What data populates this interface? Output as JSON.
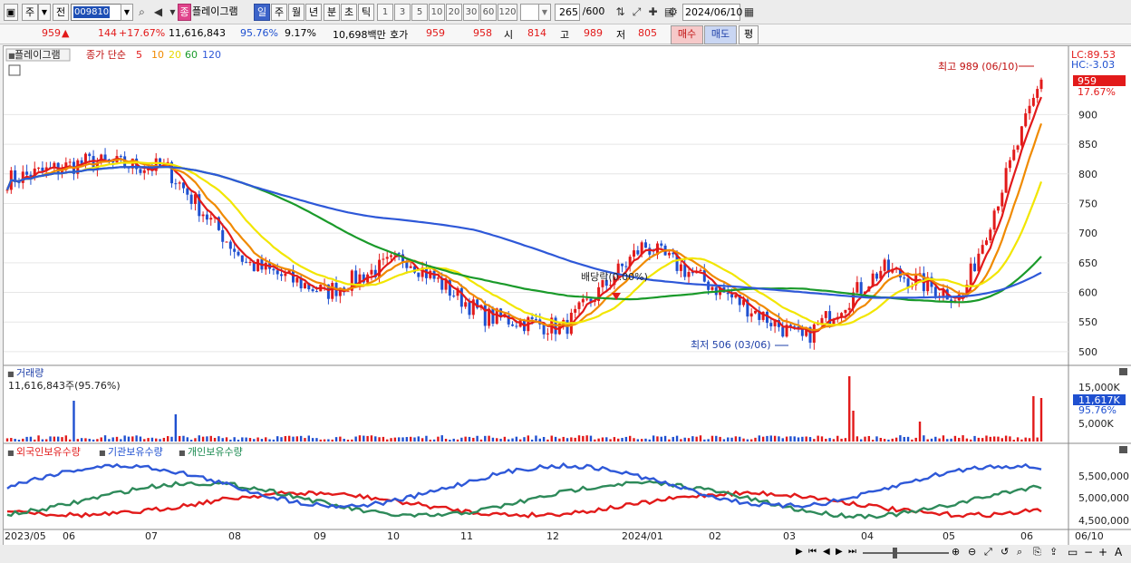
{
  "toolbar": {
    "type_label": "주",
    "prev_label": "전",
    "code": "009810",
    "program_badge": "종",
    "program_name": "플레이그램",
    "periods": [
      "일",
      "주",
      "월",
      "년",
      "분",
      "초",
      "틱"
    ],
    "minute_steps": [
      "1",
      "3",
      "5",
      "10",
      "20",
      "30",
      "60",
      "120"
    ],
    "count": "265",
    "count_total": "/600",
    "date": "2024/06/10"
  },
  "quote": {
    "price": "959",
    "change": "144",
    "change_pct": "+17.67%",
    "volume": "11,616,843",
    "vol_ratio": "95.76%",
    "turnover": "9.17%",
    "amount": "10,698백만",
    "bid_label": "호가",
    "ask": "959",
    "bid": "958",
    "open_label": "시",
    "open": "814",
    "high_label": "고",
    "high": "989",
    "low_label": "저",
    "low": "805",
    "buy_label": "매수",
    "sell_label": "매도",
    "eval_label": "평"
  },
  "legend": {
    "name": "플레이그램",
    "ma_label": "종가 단순",
    "ma5": "5",
    "ma10": "10",
    "ma20": "20",
    "ma60": "60",
    "ma120": "120",
    "volume_title": "거래량",
    "volume_value": "11,616,843주(95.76%)",
    "inv1": "외국인보유수량",
    "inv2": "기관보유수량",
    "inv3": "개인보유수량"
  },
  "price_axis": {
    "lc": "LC:89.53",
    "hc": "HC:-3.03",
    "current": "959",
    "current_pct": "17.67%",
    "ticks": [
      "900",
      "850",
      "800",
      "750",
      "700",
      "650",
      "600",
      "550",
      "500"
    ]
  },
  "volume_axis": {
    "ticks": [
      "15,000K",
      "5,000K"
    ],
    "current": "11,617K",
    "current_pct": "95.76%"
  },
  "investor_axis": {
    "ticks": [
      "5,500,000",
      "5,000,000",
      "4,500,000"
    ]
  },
  "annotations": {
    "high": "최고 989 (06/10)",
    "low": "최저 506 (03/06)",
    "dividend": "배당락(0.00%)"
  },
  "x_axis": {
    "labels": [
      "2023/05",
      "06",
      "07",
      "08",
      "09",
      "10",
      "11",
      "12",
      "2024/01",
      "02",
      "03",
      "04",
      "05",
      "06"
    ],
    "right": "06/10"
  },
  "colors": {
    "up": "#e21a1a",
    "down": "#1f50d0",
    "ma5": "#e21a1a",
    "ma10": "#f08a00",
    "ma20": "#f2e600",
    "ma60": "#1a9a2a",
    "ma120": "#2e58d8"
  },
  "chart_data": {
    "type": "line",
    "title": "",
    "price_range": [
      480,
      1000
    ],
    "points": [
      [
        "2023/05",
        790
      ],
      [
        "06",
        820
      ],
      [
        "07",
        810
      ],
      [
        "08",
        650
      ],
      [
        "09",
        600
      ],
      [
        "10",
        660
      ],
      [
        "11",
        560
      ],
      [
        "12",
        540
      ],
      [
        "2024/01",
        680
      ],
      [
        "02",
        600
      ],
      [
        "03",
        520
      ],
      [
        "04",
        640
      ],
      [
        "05",
        590
      ],
      [
        "06/10",
        959
      ]
    ],
    "annotations": [
      {
        "label": "최고 989 (06/10)",
        "value": 989
      },
      {
        "label": "최저 506 (03/06)",
        "value": 506
      }
    ]
  }
}
